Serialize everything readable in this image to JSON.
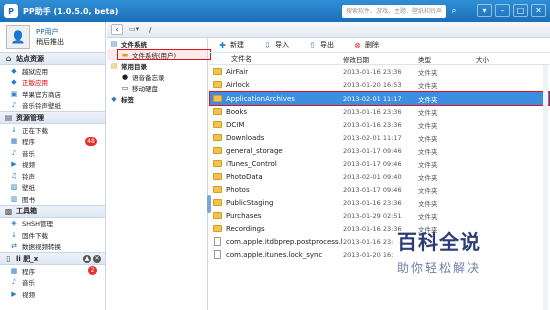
{
  "window": {
    "title": "PP助手 (1.0.5.0, beta)",
    "search_placeholder": "搜索软件、游戏、主题、壁纸和铃声"
  },
  "user": {
    "name": "PP用户",
    "action": "稍后推出"
  },
  "sidebar": {
    "sections": [
      {
        "label": "站点资源",
        "items": [
          {
            "label": "越狱应用"
          },
          {
            "label": "正版应用",
            "active": true
          },
          {
            "label": "苹果官方商店"
          },
          {
            "label": "音乐铃声壁纸"
          }
        ]
      },
      {
        "label": "资源管理",
        "items": [
          {
            "label": "正在下载"
          },
          {
            "label": "程序",
            "badge": "48"
          },
          {
            "label": "音乐"
          },
          {
            "label": "视频"
          },
          {
            "label": "铃声"
          },
          {
            "label": "壁纸"
          },
          {
            "label": "图书"
          }
        ]
      },
      {
        "label": "工具箱",
        "items": [
          {
            "label": "SHSH管理"
          },
          {
            "label": "固件下载"
          },
          {
            "label": "数据视频转换"
          }
        ]
      },
      {
        "label": "li 肥_x",
        "items": [
          {
            "label": "程序",
            "badge": "2"
          },
          {
            "label": "音乐"
          },
          {
            "label": "视频"
          }
        ]
      }
    ]
  },
  "nav": {
    "path": "/"
  },
  "tree": {
    "groups": [
      {
        "label": "文件系统",
        "children": [
          {
            "label": "文件系统(用户)",
            "selected": true
          }
        ]
      },
      {
        "label": "常用目录",
        "children": [
          {
            "label": "语音备忘录"
          },
          {
            "label": "移动硬盘"
          }
        ]
      },
      {
        "label": "标签",
        "children": []
      }
    ]
  },
  "toolbar": {
    "new": "新建",
    "import": "导入",
    "export": "导出",
    "delete": "删除"
  },
  "table": {
    "columns": [
      "文件名",
      "修改日期",
      "类型",
      "大小"
    ],
    "rows": [
      {
        "name": "AirFair",
        "date": "2013-01-16 23:36",
        "type": "文件夹",
        "size": "",
        "kind": "folder"
      },
      {
        "name": "Airlock",
        "date": "2013-01-20 16:53",
        "type": "文件夹",
        "size": "",
        "kind": "folder"
      },
      {
        "name": "ApplicationArchives",
        "date": "2013-02-01 11:17",
        "type": "文件夹",
        "size": "",
        "kind": "folder",
        "selected": true
      },
      {
        "name": "Books",
        "date": "2013-01-16 23:36",
        "type": "文件夹",
        "size": "",
        "kind": "folder"
      },
      {
        "name": "DCIM",
        "date": "2013-01-16 23:36",
        "type": "文件夹",
        "size": "",
        "kind": "folder"
      },
      {
        "name": "Downloads",
        "date": "2013-02-01 11:17",
        "type": "文件夹",
        "size": "",
        "kind": "folder"
      },
      {
        "name": "general_storage",
        "date": "2013-01-17 09:46",
        "type": "文件夹",
        "size": "",
        "kind": "folder"
      },
      {
        "name": "iTunes_Control",
        "date": "2013-01-17 09:46",
        "type": "文件夹",
        "size": "",
        "kind": "folder"
      },
      {
        "name": "PhotoData",
        "date": "2013-02-01 09:40",
        "type": "文件夹",
        "size": "",
        "kind": "folder"
      },
      {
        "name": "Photos",
        "date": "2013-01-17 09:46",
        "type": "文件夹",
        "size": "",
        "kind": "folder"
      },
      {
        "name": "PublicStaging",
        "date": "2013-01-16 23:36",
        "type": "文件夹",
        "size": "",
        "kind": "folder"
      },
      {
        "name": "Purchases",
        "date": "2013-01-29 02:51",
        "type": "文件夹",
        "size": "",
        "kind": "folder"
      },
      {
        "name": "Recordings",
        "date": "2013-01-16 23:36",
        "type": "文件夹",
        "size": "",
        "kind": "folder"
      },
      {
        "name": "com.apple.itdbprep.postprocess.lo...",
        "date": "2013-01-16 23:",
        "type": "",
        "size": "",
        "kind": "file"
      },
      {
        "name": "com.apple.itunes.lock_sync",
        "date": "2013-01-20 16:",
        "type": "",
        "size": "",
        "kind": "file"
      }
    ]
  },
  "watermark": {
    "big": "百科全说",
    "small": "助你轻松解决"
  },
  "colors": {
    "titlebar": "#1c6fb8",
    "selection": "#3c8fe0",
    "highlight_box": "#e0101e"
  }
}
